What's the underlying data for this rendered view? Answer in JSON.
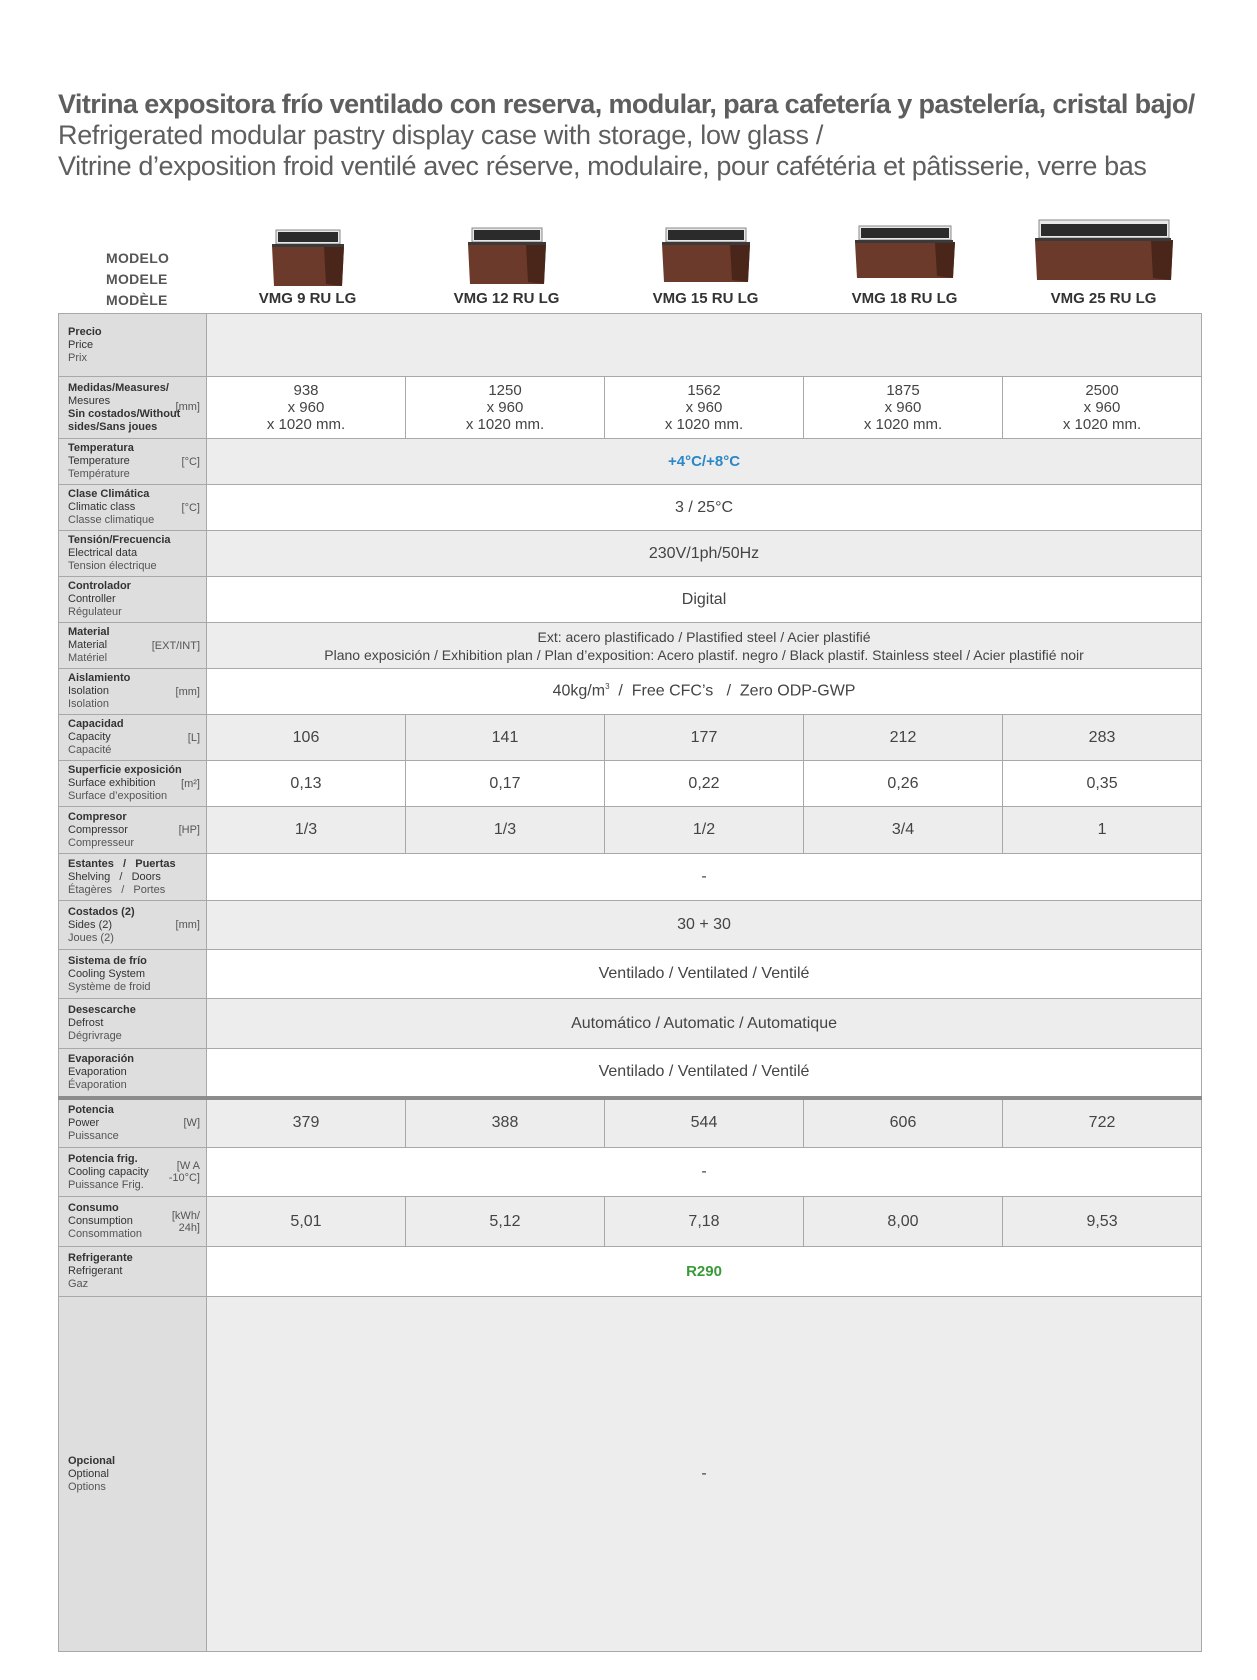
{
  "title": {
    "es": "Vitrina expositora frío ventilado con reserva, modular, para cafetería y pastelería, cristal bajo/",
    "en": "Refrigerated modular pastry display case with storage, low glass /",
    "fr": "Vitrine d’exposition froid ventilé avec réserve, modulaire, pour cafétéria et pâtisserie, verre bas"
  },
  "model_label": {
    "es": "MODELO",
    "en": "MODELE",
    "fr": "MODÈLE"
  },
  "models": [
    "VMG 9 RU LG",
    "VMG 12 RU LG",
    "VMG 15 RU LG",
    "VMG 18 RU LG",
    "VMG 25 RU LG"
  ],
  "rows": {
    "price": {
      "es": "Precio",
      "en": "Price",
      "fr": "Prix"
    },
    "measures": {
      "es": "Medidas/Measures/",
      "en": "Mesures",
      "sub1": "Sin costados/Without",
      "sub2": "sides/Sans joues",
      "unit": "[mm]",
      "values": [
        {
          "w": "938",
          "d": "x 960",
          "h": "x 1020 mm."
        },
        {
          "w": "1250",
          "d": "x 960",
          "h": "x 1020 mm."
        },
        {
          "w": "1562",
          "d": "x 960",
          "h": "x 1020 mm."
        },
        {
          "w": "1875",
          "d": "x 960",
          "h": "x 1020 mm."
        },
        {
          "w": "2500",
          "d": "x 960",
          "h": "x 1020 mm."
        }
      ]
    },
    "temperature": {
      "es": "Temperatura",
      "en": "Temperature",
      "fr": "Température",
      "unit": "[°C]",
      "value": "+4°C/+8°C"
    },
    "climatic": {
      "es": "Clase Climática",
      "en": "Climatic class",
      "fr": "Classe climatique",
      "unit": "[°C]",
      "value": "3 / 25°C"
    },
    "electrical": {
      "es": "Tensión/Frecuencia",
      "en": "Electrical data",
      "fr": "Tension électrique",
      "value": "230V/1ph/50Hz"
    },
    "controller": {
      "es": "Controlador",
      "en": "Controller",
      "fr": "Régulateur",
      "value": "Digital"
    },
    "material": {
      "es": "Material",
      "en": "Material",
      "fr": "Matériel",
      "unit": "[EXT/INT]",
      "line1": "Ext: acero plastificado / Plastified steel / Acier plastifié",
      "line2": "Plano exposición / Exhibition plan / Plan d’exposition:  Acero plastif. negro / Black plastif. Stainless steel / Acier plastifié noir"
    },
    "isolation": {
      "es": "Aislamiento",
      "en": "Isolation",
      "fr": "Isolation",
      "unit": "[mm]",
      "value_a": "40kg/m",
      "value_sup": "3",
      "value_b": "  /  Free CFC’s   /  Zero ODP-GWP"
    },
    "capacity": {
      "es": "Capacidad",
      "en": "Capacity",
      "fr": "Capacité",
      "unit": "[L]",
      "values": [
        "106",
        "141",
        "177",
        "212",
        "283"
      ]
    },
    "surface": {
      "es": "Superficie exposición",
      "en": "Surface exhibition",
      "fr": "Surface d’exposition",
      "unit": "[m²]",
      "values": [
        "0,13",
        "0,17",
        "0,22",
        "0,26",
        "0,35"
      ]
    },
    "compressor": {
      "es": "Compresor",
      "en": "Compressor",
      "fr": "Compresseur",
      "unit": "[HP]",
      "values": [
        "1/3",
        "1/3",
        "1/2",
        "3/4",
        "1"
      ]
    },
    "shelving": {
      "es": "Estantes   /   Puertas",
      "en": "Shelving   /   Doors",
      "fr": "Étagères   /   Portes",
      "value": "-"
    },
    "sides": {
      "es": "Costados (2)",
      "en": "Sides (2)",
      "fr": "Joues (2)",
      "unit": "[mm]",
      "value": "30 + 30"
    },
    "cooling": {
      "es": "Sistema de frío",
      "en": "Cooling System",
      "fr": "Système de froid",
      "value": "Ventilado / Ventilated / Ventilé"
    },
    "defrost": {
      "es": "Desescarche",
      "en": "Defrost",
      "fr": "Dégrivrage",
      "value": "Automático / Automatic / Automatique"
    },
    "evaporation": {
      "es": "Evaporación",
      "en": "Evaporation",
      "fr": "Évaporation",
      "value": "Ventilado / Ventilated / Ventilé"
    },
    "power": {
      "es": "Potencia",
      "en": "Power",
      "fr": "Puissance",
      "unit": "[W]",
      "values": [
        "379",
        "388",
        "544",
        "606",
        "722"
      ]
    },
    "cooling_capacity": {
      "es": "Potencia frig.",
      "en": "Cooling capacity",
      "fr": "Puissance Frig.",
      "unit1": "[W A",
      "unit2": "-10°C]",
      "value": "-"
    },
    "consumption": {
      "es": "Consumo",
      "en": "Consumption",
      "fr": "Consommation",
      "unit1": "[kWh/",
      "unit2": "24h]",
      "values": [
        "5,01",
        "5,12",
        "7,18",
        "8,00",
        "9,53"
      ]
    },
    "refrigerant": {
      "es": "Refrigerante",
      "en": "Refrigerant",
      "fr": "Gaz",
      "value": "R290"
    },
    "optional": {
      "es": "Opcional",
      "en": "Optional",
      "fr": "Options",
      "value": "-"
    }
  },
  "colors": {
    "title": "#5e5e5e",
    "label_bg": "#dedede",
    "row_grey": "#ededed",
    "temp": "#2a87c8",
    "refrigerant": "#3a9a3a"
  }
}
